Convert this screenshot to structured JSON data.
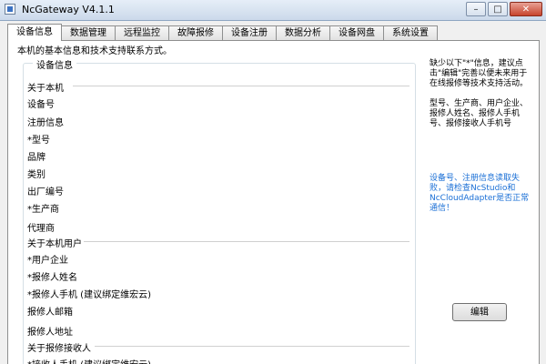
{
  "window": {
    "title": "NcGateway V4.1.1",
    "minimize": "–",
    "maximize": "□",
    "close": "✕"
  },
  "tabs": [
    {
      "label": "设备信息",
      "active": true
    },
    {
      "label": "数据管理"
    },
    {
      "label": "远程监控"
    },
    {
      "label": "故障报修"
    },
    {
      "label": "设备注册"
    },
    {
      "label": "数据分析"
    },
    {
      "label": "设备网盘"
    },
    {
      "label": "系统设置"
    }
  ],
  "panel": {
    "intro": "本机的基本信息和技术支持联系方式。",
    "group_title": "设备信息"
  },
  "sections": {
    "machine": {
      "title": "关于本机",
      "fields": [
        "设备号",
        "注册信息",
        "*型号",
        "品牌",
        "类别",
        "出厂编号",
        "*生产商",
        "代理商"
      ]
    },
    "user": {
      "title": "关于本机用户",
      "fields": [
        "*用户企业",
        "*报修人姓名",
        "*报修人手机 (建议绑定维宏云)",
        "报修人邮箱",
        "报修人地址"
      ]
    },
    "receiver": {
      "title": "关于报修接收人",
      "fields": [
        "*接收人手机 (建议绑定维宏云)"
      ]
    }
  },
  "side": {
    "hint1": "缺少以下\"*\"信息，建议点击\"编辑\"完善以便未来用于在线报修等技术支持活动。",
    "hint2": "型号、生产商、用户企业、报修人姓名、报修人手机号、报修接收人手机号",
    "blue": "设备号、注册信息读取失败，请检查NcStudio和NcCloudAdapter是否正常通信！"
  },
  "edit_button": "编辑",
  "colors": {
    "blue_text": "#1a6fd6"
  }
}
